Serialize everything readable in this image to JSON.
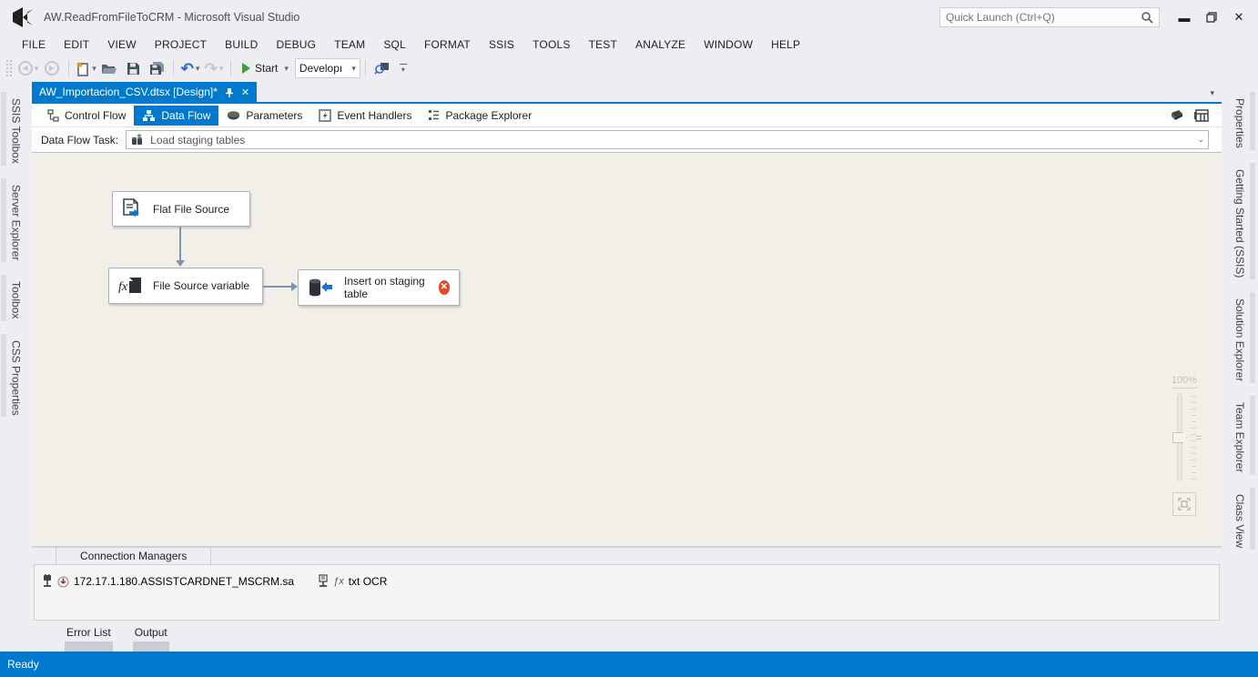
{
  "window": {
    "title": "AW.ReadFromFileToCRM - Microsoft Visual Studio",
    "quick_launch_placeholder": "Quick Launch (Ctrl+Q)",
    "status": "Ready"
  },
  "menu": {
    "items": [
      "FILE",
      "EDIT",
      "VIEW",
      "PROJECT",
      "BUILD",
      "DEBUG",
      "TEAM",
      "SQL",
      "FORMAT",
      "SSIS",
      "TOOLS",
      "TEST",
      "ANALYZE",
      "WINDOW",
      "HELP"
    ]
  },
  "toolbar": {
    "start_label": "Start",
    "config_value": "Developı"
  },
  "document_tab": {
    "label": "AW_Importacion_CSV.dtsx [Design]*"
  },
  "designer_tabs": [
    {
      "label": "Control Flow"
    },
    {
      "label": "Data Flow"
    },
    {
      "label": "Parameters"
    },
    {
      "label": "Event Handlers"
    },
    {
      "label": "Package Explorer"
    }
  ],
  "data_flow_task": {
    "label": "Data Flow Task:",
    "value": "Load staging tables"
  },
  "canvas": {
    "nodes": [
      {
        "label": "Flat File Source",
        "type": "flat-file-source"
      },
      {
        "label": "File Source variable",
        "type": "derived-column"
      },
      {
        "label": "Insert on staging table",
        "type": "oledb-destination",
        "error": true
      }
    ],
    "zoom_level": "100%"
  },
  "left_tabs": [
    "SSIS Toolbox",
    "Server Explorer",
    "Toolbox",
    "CSS Properties"
  ],
  "right_tabs": [
    "Properties",
    "Getting Started (SSIS)",
    "Solution Explorer",
    "Team Explorer",
    "Class View"
  ],
  "connection_managers": {
    "tab_label": "Connection Managers",
    "items": [
      {
        "label": "172.17.1.180.ASSISTCARDNET_MSCRM.sa"
      },
      {
        "label": "txt OCR",
        "fx": "ƒx"
      }
    ]
  },
  "bottom_tabs": [
    "Error List",
    "Output"
  ],
  "colors": {
    "accent": "#007acc",
    "canvas_bg": "#f2efe9",
    "error": "#dd4b26",
    "arrow": "#7d96ae"
  }
}
